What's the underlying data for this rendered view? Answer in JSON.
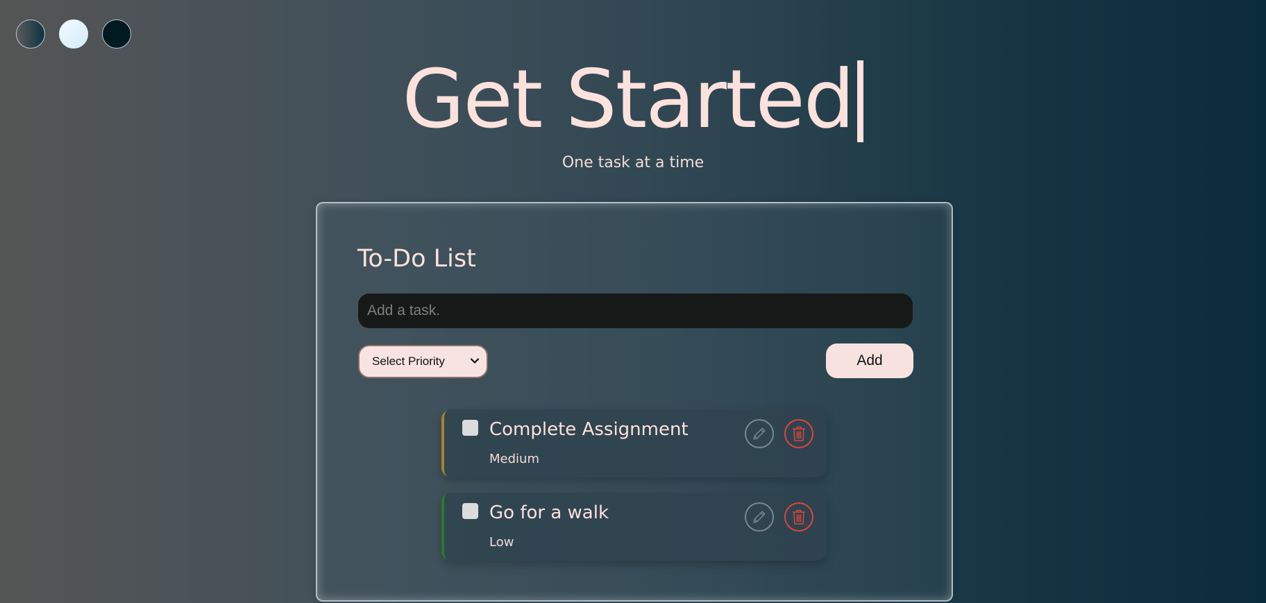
{
  "theme_switcher": {
    "options": [
      "gradient-theme",
      "light-theme",
      "dark-theme"
    ]
  },
  "hero": {
    "title": "Get Started",
    "subtitle": "One task at a time"
  },
  "todo": {
    "title": "To-Do List",
    "input_placeholder": "Add a task.",
    "input_value": "",
    "priority_selected": "Select Priority",
    "add_label": "Add"
  },
  "tasks": [
    {
      "text": "Complete Assignment",
      "priority": "Medium",
      "accent_color": "#a8822a",
      "checked": false
    },
    {
      "text": "Go for a walk",
      "priority": "Low",
      "accent_color": "#2b7a2b",
      "checked": false
    }
  ],
  "colors": {
    "accent_text": "#fde1dc",
    "delete_red": "#e0443c",
    "medium_priority": "#a8822a",
    "low_priority": "#2b7a2b"
  },
  "icons": {
    "edit": "pencil-icon",
    "delete": "trash-icon",
    "select": "chevron-down-icon"
  }
}
